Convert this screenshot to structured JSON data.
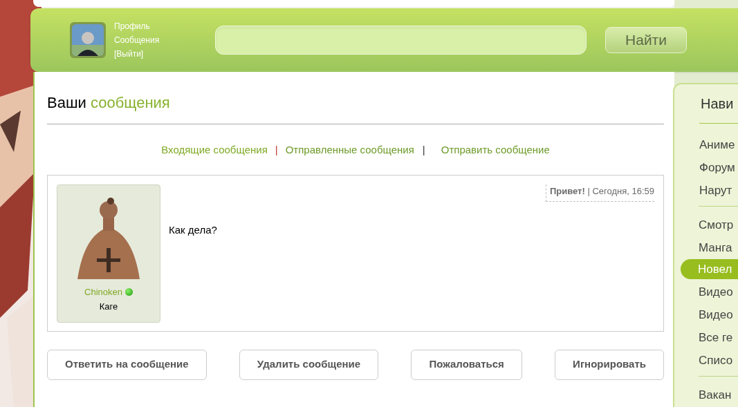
{
  "header": {
    "user_links": [
      "Профиль",
      "Сообщения",
      "[Выйти]"
    ],
    "search": {
      "button": "Найти"
    }
  },
  "page_title": {
    "plain": "Ваши",
    "accent": "сообщения"
  },
  "tab_separators": [
    "|",
    "|"
  ],
  "message_tabs": [
    {
      "label": "Входящие сообщения",
      "selected": true
    },
    {
      "label": "Отправленные сообщения",
      "selected": false
    },
    {
      "label": "Отправить сообщение",
      "selected": false
    }
  ],
  "message": {
    "sender": {
      "name": "Chinoken",
      "online": true,
      "rank": "Каге"
    },
    "subject": "Привет!",
    "meta_separator": "|",
    "date": "Сегодня, 16:59",
    "body": "Как дела?"
  },
  "actions": [
    "Ответить на сообщение",
    "Удалить сообщение",
    "Пожаловаться",
    "Игнорировать"
  ],
  "sidebar": {
    "title": "Нави",
    "groups": [
      [
        {
          "label": "Аниме",
          "selected": false
        },
        {
          "label": "Форум",
          "selected": false
        },
        {
          "label": "Нарут",
          "selected": false
        }
      ],
      [
        {
          "label": "Смотр",
          "selected": false
        },
        {
          "label": "Манга",
          "selected": false
        },
        {
          "label": "Новел",
          "selected": true
        },
        {
          "label": "Видео",
          "selected": false
        },
        {
          "label": "Видео",
          "selected": false
        },
        {
          "label": "Все ге",
          "selected": false
        },
        {
          "label": "Списо",
          "selected": false
        }
      ],
      [
        {
          "label": "Вакан",
          "selected": false
        }
      ]
    ]
  }
}
